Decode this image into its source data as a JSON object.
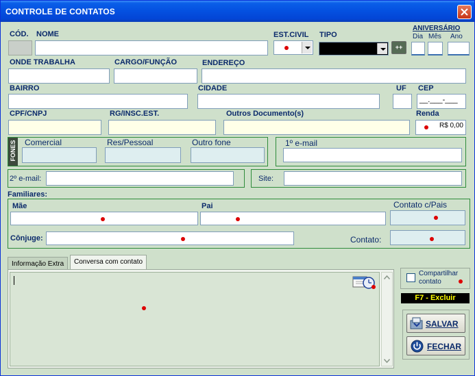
{
  "window": {
    "title": "CONTROLE DE CONTATOS"
  },
  "labels": {
    "cod": "CÓD.",
    "nome": "NOME",
    "estcivil": "EST.CIVIL",
    "tipo": "TIPO",
    "aniversario": "ANIVERSÁRIO",
    "dia": "Dia",
    "mes": "Mês",
    "ano": "Ano",
    "onde_trabalha": "ONDE TRABALHA",
    "cargo": "CARGO/FUNÇÃO",
    "endereco": "ENDEREÇO",
    "bairro": "BAIRRO",
    "cidade": "CIDADE",
    "uf": "UF",
    "cep": "CEP",
    "cpf": "CPF/CNPJ",
    "rg": "RG/INSC.EST.",
    "outros_docs": "Outros Documento(s)",
    "renda": "Renda",
    "fones": "FONES",
    "comercial": "Comercial",
    "res_pessoal": "Res/Pessoal",
    "outro_fone": "Outro fone",
    "email1": "1º e-mail",
    "email2": "2º e-mail:",
    "site": "Site:",
    "familiares": "Familiares:",
    "mae": "Mãe",
    "pai": "Pai",
    "contato_pais": "Contato c/Pais",
    "conjuge": "Cônjuge:",
    "contato": "Contato:"
  },
  "values": {
    "cep": "__.___-___",
    "renda": "R$ 0,00"
  },
  "buttons": {
    "tipo_add": "++",
    "salvar": "SALVAR",
    "fechar": "FECHAR",
    "excluir": "F7 - Excluir"
  },
  "tabs": [
    "Informação Extra",
    "Conversa com contato"
  ],
  "checkbox": {
    "compartilhar": "Compartilhar contato",
    "checked": false
  },
  "colors": {
    "title_bar": "#0450e0",
    "panel": "#cfe0cb",
    "label": "#0b2a6b",
    "group_border": "#2e8b3a",
    "required_dot": "#dd0000",
    "excluir_bg": "#000000",
    "excluir_text": "#ffff00"
  },
  "icons": [
    "close-icon",
    "dropdown-arrow-icon",
    "calendar-clock-icon",
    "save-icon",
    "power-icon",
    "scroll-up-icon",
    "scroll-down-icon"
  ]
}
